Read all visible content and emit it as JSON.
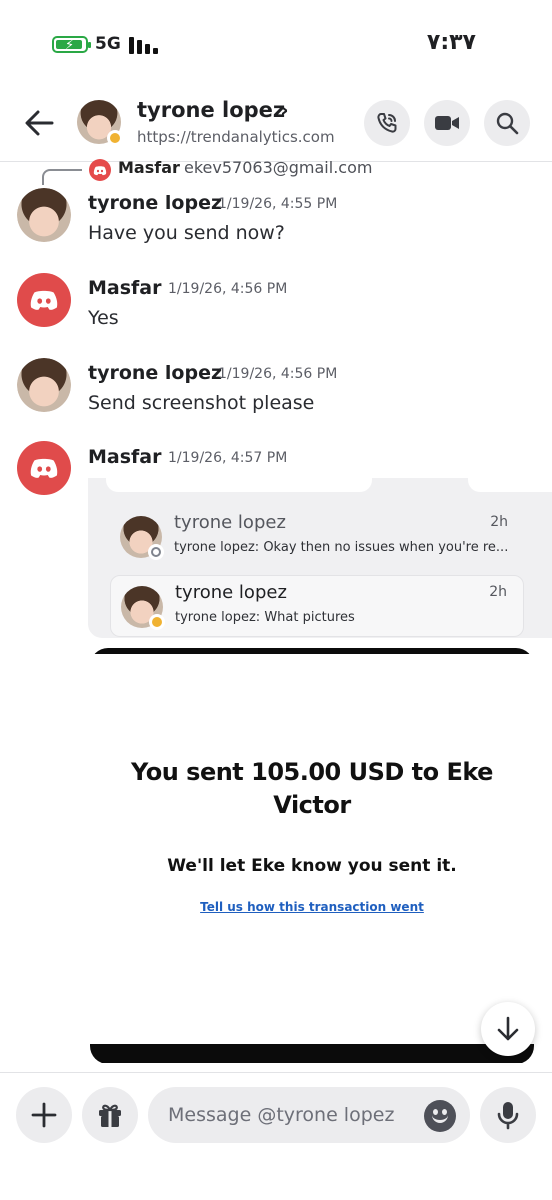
{
  "status_bar": {
    "network": "5G",
    "time": "۷:۳۷"
  },
  "header": {
    "name": "tyrone lopez",
    "chevron": "›",
    "subtitle": "https://trendanalytics.com"
  },
  "reply_reference": {
    "name": "Masfar",
    "text": "ekev57063@gmail.com"
  },
  "messages": [
    {
      "author": "tyrone lopez",
      "time": "1/19/26, 4:55 PM",
      "text": "Have you send now?"
    },
    {
      "author": "Masfar",
      "time": "1/19/26, 4:56 PM",
      "text": "Yes"
    },
    {
      "author": "tyrone lopez",
      "time": "1/19/26, 4:56 PM",
      "text": "Send screenshot please"
    },
    {
      "author": "Masfar",
      "time": "1/19/26, 4:57 PM",
      "text": ""
    }
  ],
  "attachment": {
    "dm_rows": [
      {
        "name": "tyrone lopez",
        "time": "2h",
        "preview": "tyrone lopez: Okay then no issues when you're re..."
      },
      {
        "name": "tyrone lopez",
        "time": "2h",
        "preview": "tyrone lopez: What pictures"
      }
    ],
    "payment": {
      "title": "You sent 105.00 USD to Eke Victor",
      "subtitle": "We'll let Eke know you sent it.",
      "link": "Tell us how this transaction went"
    }
  },
  "composer": {
    "placeholder": "Message @tyrone lopez"
  },
  "colors": {
    "discord_red": "#e04b4b",
    "idle_status": "#f0b232",
    "link_blue": "#1f5fbf",
    "battery_green": "#2aa845"
  }
}
